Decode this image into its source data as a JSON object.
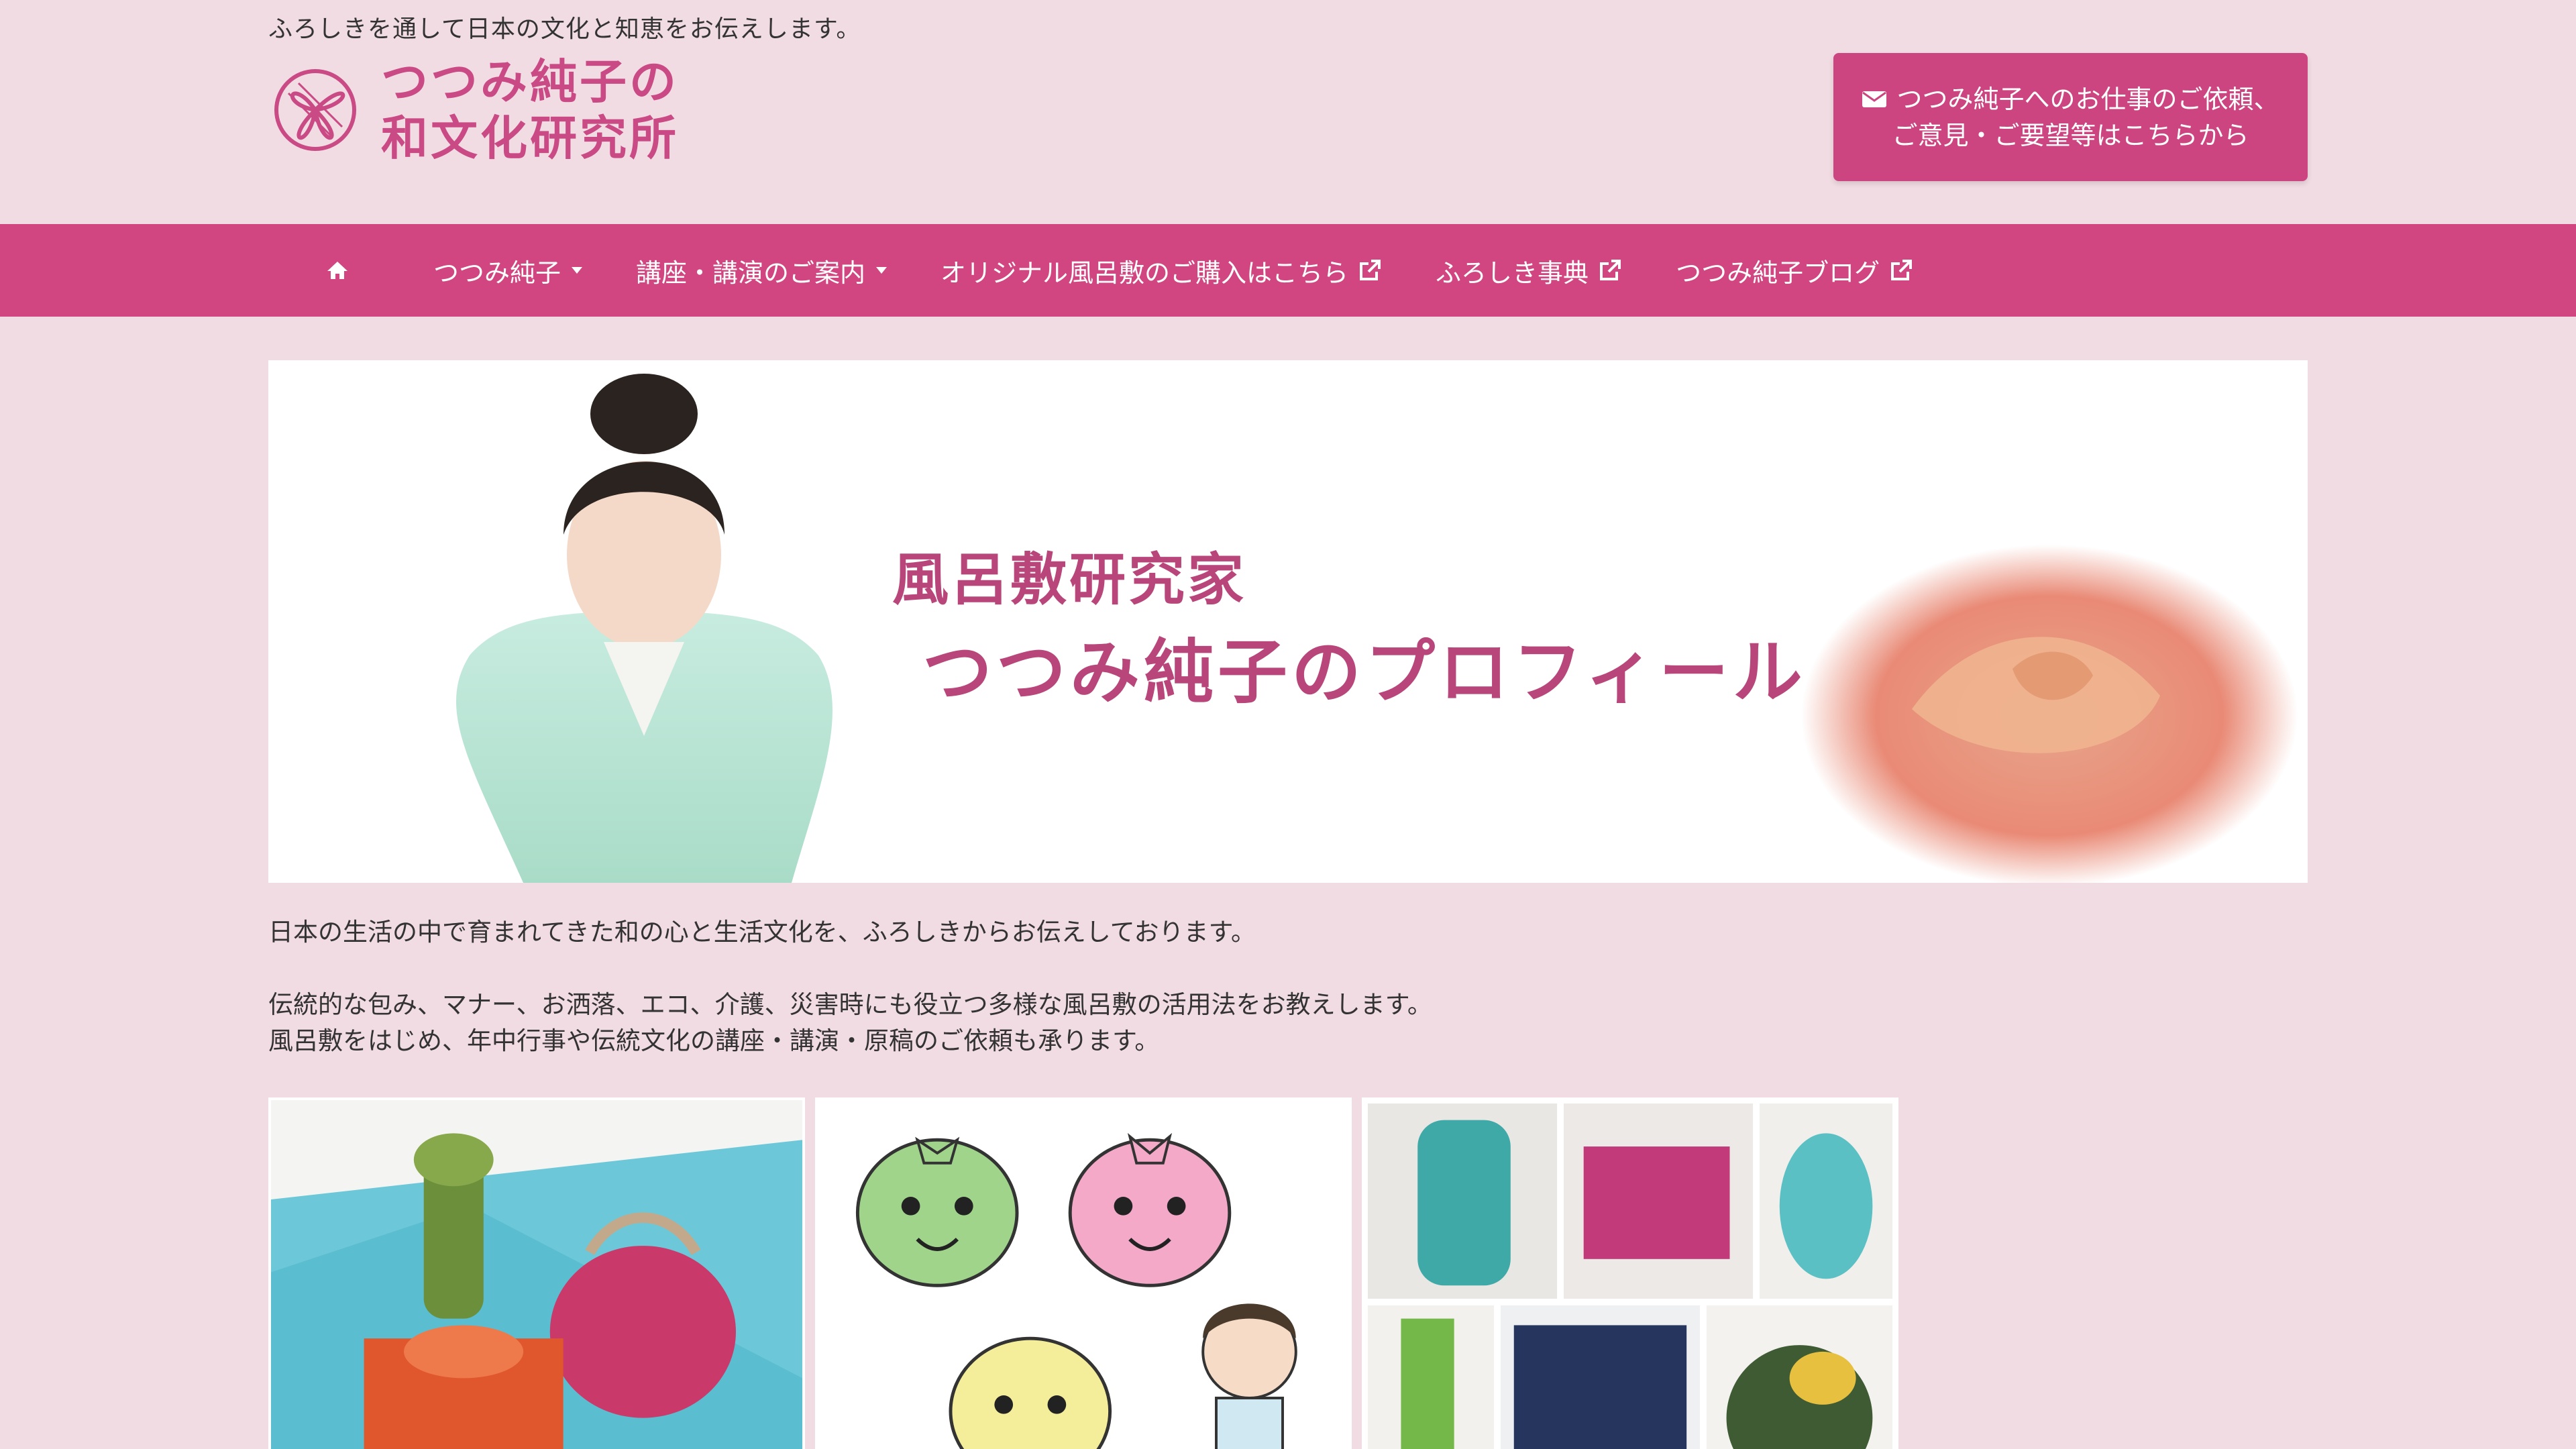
{
  "header": {
    "tagline": "ふろしきを通して日本の文化と知恵をお伝えします。",
    "logo_line1": "つつみ純子の",
    "logo_line2": "和文化研究所",
    "contact_line1": "つつみ純子へのお仕事のご依頼、",
    "contact_line2": "ご意見・ご要望等はこちらから"
  },
  "nav": {
    "items": [
      {
        "label": "つつみ純子",
        "icon": "caret-down-icon"
      },
      {
        "label": "講座・講演のご案内",
        "icon": "caret-down-icon"
      },
      {
        "label": "オリジナル風呂敷のご購入はこちら",
        "icon": "external-link-icon"
      },
      {
        "label": "ふろしき事典",
        "icon": "external-link-icon"
      },
      {
        "label": "つつみ純子ブログ",
        "icon": "external-link-icon"
      }
    ]
  },
  "hero": {
    "subtitle": "風呂敷研究家",
    "title": "つつみ純子のプロフィール"
  },
  "intro": {
    "p1": "日本の生活の中で育まれてきた和の心と生活文化を、ふろしきからお伝えしております。",
    "p2a": "伝統的な包み、マナー、お洒落、エコ、介護、災害時にも役立つ多様な風呂敷の活用法をお教えします。",
    "p2b": "風呂敷をはじめ、年中行事や伝統文化の講座・講演・原稿のご依頼も承ります。"
  },
  "colors": {
    "background": "#f2dce3",
    "accent": "#d14581",
    "logo": "#c94a84"
  }
}
